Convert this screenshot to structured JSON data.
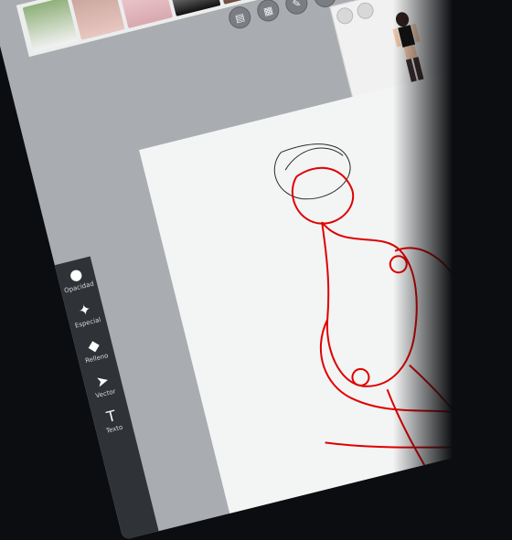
{
  "toolbar": {
    "icons": [
      "layers-icon",
      "grid-icon",
      "brush-icon",
      "pencil-icon",
      "image-icon"
    ]
  },
  "reference_strip": {
    "thumbnails": [
      "photo-thumb-1",
      "photo-thumb-2",
      "photo-thumb-3",
      "photo-thumb-4",
      "photo-thumb-5",
      "photo-thumb-6"
    ]
  },
  "left_tools": [
    {
      "label": "Opacidad",
      "icon": "drop-icon"
    },
    {
      "label": "Especial",
      "icon": "sparkle-icon"
    },
    {
      "label": "Relleno",
      "icon": "fill-icon"
    },
    {
      "label": "Vector",
      "icon": "cursor-icon"
    },
    {
      "label": "Texto",
      "icon": "text-icon"
    }
  ],
  "colors": {
    "sketch": "#e00000",
    "underdrawing": "#2a2a2a",
    "canvas": "#f3f4f4"
  }
}
